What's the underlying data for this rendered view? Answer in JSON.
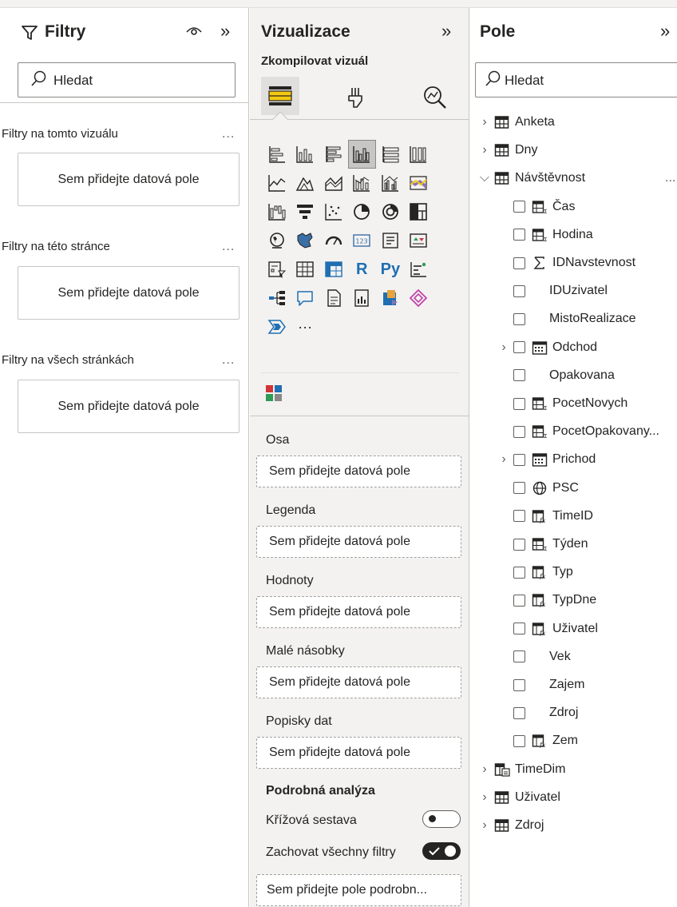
{
  "filters": {
    "title": "Filtry",
    "search_placeholder": "Hledat",
    "sections": [
      {
        "label": "Filtry na tomto vizuálu",
        "more": "...",
        "drop": "Sem přidejte datová pole"
      },
      {
        "label": "Filtry na této stránce",
        "more": "...",
        "drop": "Sem přidejte datová pole"
      },
      {
        "label": "Filtry na všech stránkách",
        "more": "...",
        "drop": "Sem přidejte datová pole"
      }
    ]
  },
  "viz": {
    "title": "Vizualizace",
    "build_label": "Zkompilovat vizuál",
    "more_visuals": "···",
    "r_label": "R",
    "py_label": "Py",
    "wells": [
      {
        "label": "Osa",
        "drop": "Sem přidejte datová pole"
      },
      {
        "label": "Legenda",
        "drop": "Sem přidejte datová pole"
      },
      {
        "label": "Hodnoty",
        "drop": "Sem přidejte datová pole"
      },
      {
        "label": "Malé násobky",
        "drop": "Sem přidejte datová pole"
      },
      {
        "label": "Popisky dat",
        "drop": "Sem přidejte datová pole"
      }
    ],
    "drill_title": "Podrobná analýza",
    "cross_report_label": "Křížová sestava",
    "cross_report_on": false,
    "keep_filters_label": "Zachovat všechny filtry",
    "keep_filters_on": true,
    "drill_drop": "Sem přidejte pole podrobn..."
  },
  "fields": {
    "title": "Pole",
    "search_placeholder": "Hledat",
    "tables_top": [
      {
        "name": "Anketa",
        "icon": "table-icon"
      },
      {
        "name": "Dny",
        "icon": "table-icon"
      }
    ],
    "expanded_table": {
      "name": "Návštěvnost",
      "icon": "table-icon",
      "more": "..."
    },
    "items": [
      {
        "name": "Čas",
        "icon": "column-icon",
        "expandable": false
      },
      {
        "name": "Hodina",
        "icon": "column-icon",
        "expandable": false
      },
      {
        "name": "IDNavstevnost",
        "icon": "sigma-icon",
        "expandable": false
      },
      {
        "name": "IDUzivatel",
        "icon": "",
        "expandable": false
      },
      {
        "name": "MistoRealizace",
        "icon": "",
        "expandable": false
      },
      {
        "name": "Odchod",
        "icon": "calendar-icon",
        "expandable": true
      },
      {
        "name": "Opakovana",
        "icon": "",
        "expandable": false
      },
      {
        "name": "PocetNovych",
        "icon": "column-icon",
        "expandable": false
      },
      {
        "name": "PocetOpakovany...",
        "icon": "column-icon",
        "expandable": false
      },
      {
        "name": "Prichod",
        "icon": "calendar-icon",
        "expandable": true
      },
      {
        "name": "PSC",
        "icon": "globe-icon",
        "expandable": false
      },
      {
        "name": "TimeID",
        "icon": "calc-column-icon",
        "expandable": false
      },
      {
        "name": "Týden",
        "icon": "column-icon",
        "expandable": false
      },
      {
        "name": "Typ",
        "icon": "calc-column-icon",
        "expandable": false
      },
      {
        "name": "TypDne",
        "icon": "calc-column-icon",
        "expandable": false
      },
      {
        "name": "Uživatel",
        "icon": "calc-column-icon",
        "expandable": false
      },
      {
        "name": "Vek",
        "icon": "",
        "expandable": false
      },
      {
        "name": "Zajem",
        "icon": "",
        "expandable": false
      },
      {
        "name": "Zdroj",
        "icon": "",
        "expandable": false
      },
      {
        "name": "Zem",
        "icon": "calc-column-icon",
        "expandable": false
      }
    ],
    "tables_bottom": [
      {
        "name": "TimeDim",
        "icon": "date-table-icon"
      },
      {
        "name": "Uživatel",
        "icon": "table-icon"
      },
      {
        "name": "Zdroj",
        "icon": "table-icon"
      }
    ]
  },
  "colors": {
    "accent_yellow": "#f2c811",
    "toggle_on": "#252423",
    "selected_tile": "#c8c6c4"
  }
}
